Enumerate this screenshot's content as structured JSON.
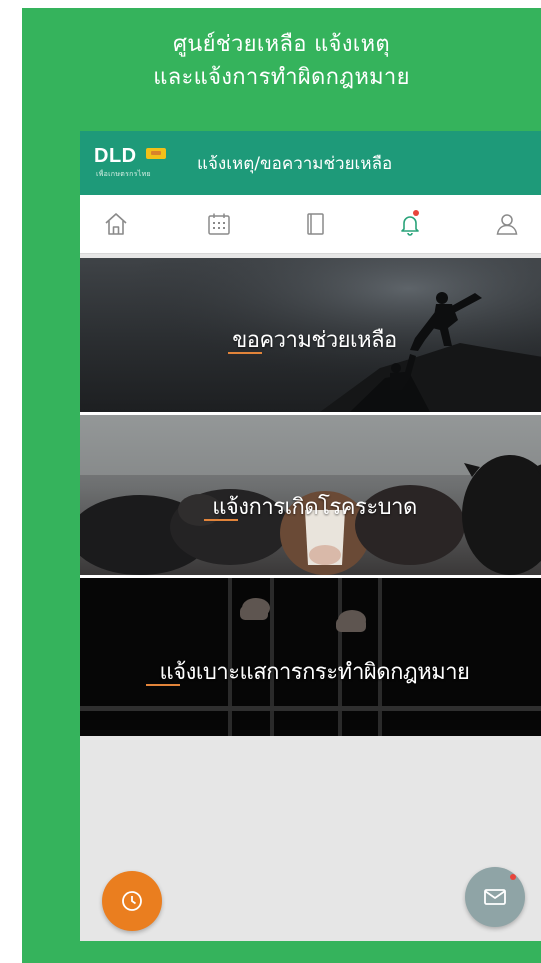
{
  "header": {
    "line1": "ศูนย์ช่วยเหลือ แจ้งเหตุ",
    "line2": "และแจ้งการทำผิดกฎหมาย"
  },
  "appbar": {
    "logo": "DLD",
    "logo_sub": "เพื่อเกษตรกรไทย",
    "title": "แจ้งเหตุ/ขอความช่วยเหลือ"
  },
  "tabs": [
    {
      "icon": "home-icon"
    },
    {
      "icon": "calendar-icon"
    },
    {
      "icon": "book-icon"
    },
    {
      "icon": "bell-icon",
      "active": true
    },
    {
      "icon": "user-icon"
    }
  ],
  "banners": [
    {
      "label": "ขอความช่วยเหลือ",
      "image": "climbers-helping-hand-silhouette"
    },
    {
      "label": "แจ้งการเกิดโรคระบาด",
      "image": "cattle-herd"
    },
    {
      "label": "แจ้งเบาะแสการกระทำผิดกฎหมาย",
      "image": "hands-gripping-prison-bars"
    }
  ],
  "fabs": {
    "left_icon": "clock-icon",
    "right_icon": "mail-icon"
  },
  "colors": {
    "frame_green": "#35b35c",
    "appbar_teal": "#1e9a79",
    "active_tab": "#2aa37a",
    "fab_orange": "#ea7e1f",
    "fab_gray": "#8fa4a6",
    "accent_underline": "#e2843a"
  }
}
